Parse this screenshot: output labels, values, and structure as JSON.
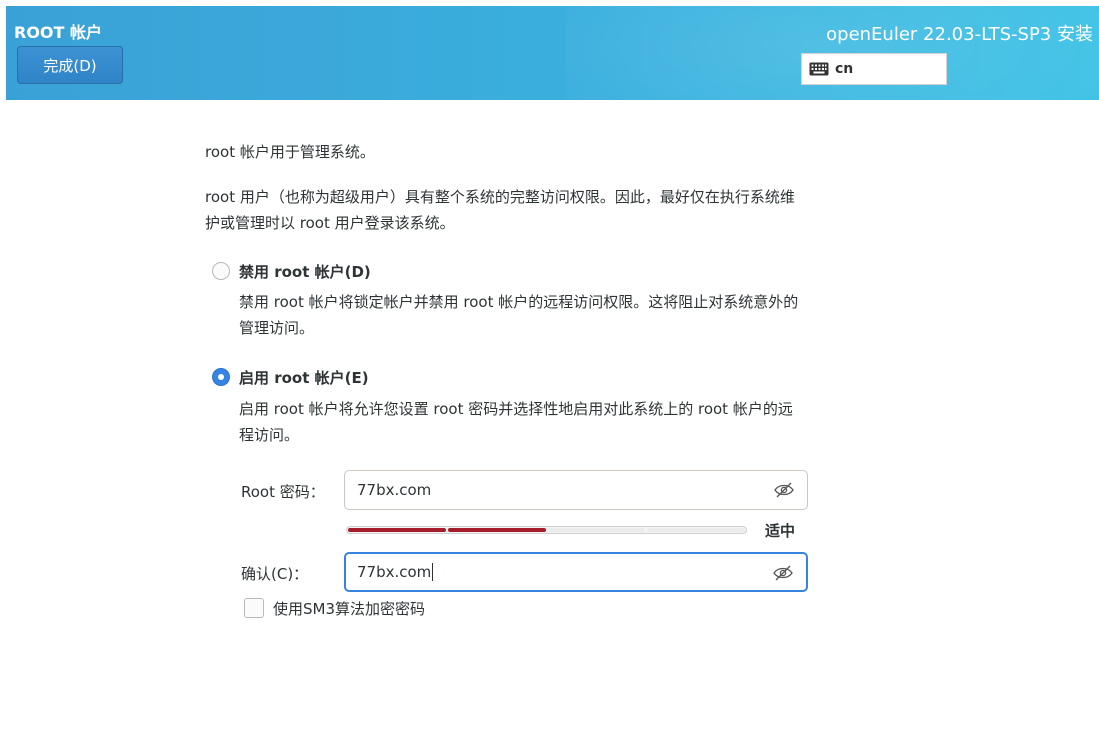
{
  "header": {
    "title": "ROOT 帐户",
    "done_button": "完成(D)",
    "product": "openEuler 22.03-LTS-SP3 安装",
    "keyboard_layout": "cn"
  },
  "content": {
    "intro": "root 帐户用于管理系统。",
    "desc_line1": "root 用户（也称为超级用户）具有整个系统的完整访问权限。因此，最好仅在执行系统维",
    "desc_line2": "护或管理时以 root 用户登录该系统。",
    "disable_option": {
      "label": "禁用 root 帐户(D)",
      "desc_line1": "禁用 root 帐户将锁定帐户并禁用 root 帐户的远程访问权限。这将阻止对系统意外的",
      "desc_line2": "管理访问。",
      "selected": false
    },
    "enable_option": {
      "label": "启用 root 帐户(E)",
      "desc_line1": "启用 root 帐户将允许您设置 root 密码并选择性地启用对此系统上的 root 帐户的远",
      "desc_line2": "程访问。",
      "selected": true
    },
    "password": {
      "label": "Root 密码：",
      "value": "77bx.com"
    },
    "strength": {
      "text": "适中",
      "level": 0.5,
      "segments": 4,
      "filled_segments": 2,
      "fill_color": "#a51d2d"
    },
    "confirm": {
      "label": "确认(C)：",
      "value": "77bx.com"
    },
    "sm3_checkbox": {
      "label": "使用SM3算法加密密码",
      "checked": false
    }
  },
  "colors": {
    "accent": "#3584e4",
    "header_start": "#3aa1d6",
    "header_end": "#41c3e6"
  }
}
